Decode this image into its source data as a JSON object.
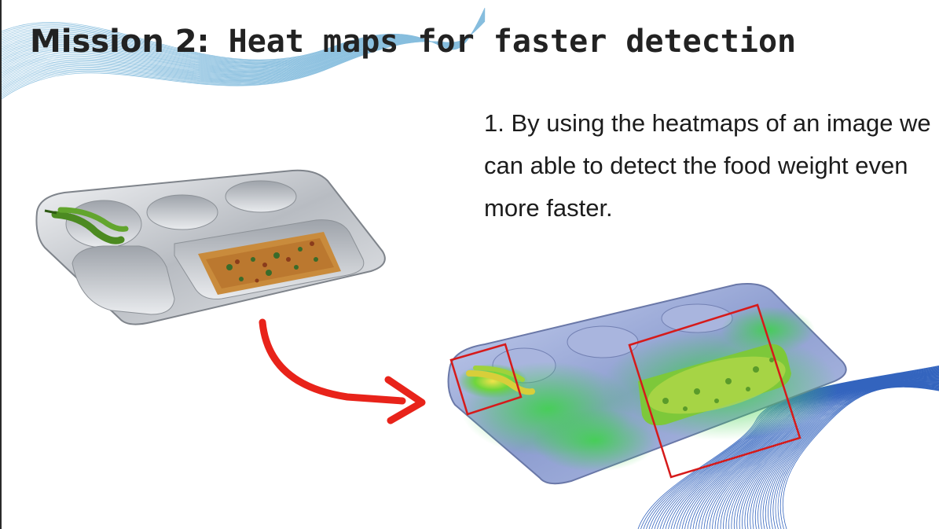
{
  "slide": {
    "title_part1": "Mission 2:",
    "title_part2": " Heat maps for faster detection",
    "description": "1. By using the heatmaps of an image we can able to detect the food weight even more faster."
  },
  "colors": {
    "title": "#222222",
    "text": "#1c1c1c",
    "arrow": "#e8231a",
    "box": "#d61a1a",
    "wave_top": "#6aaed6",
    "wave_bottom": "#1f55b8",
    "tray": "#c9cdd3"
  },
  "icons": {
    "arrow": "curved-arrow-icon"
  }
}
